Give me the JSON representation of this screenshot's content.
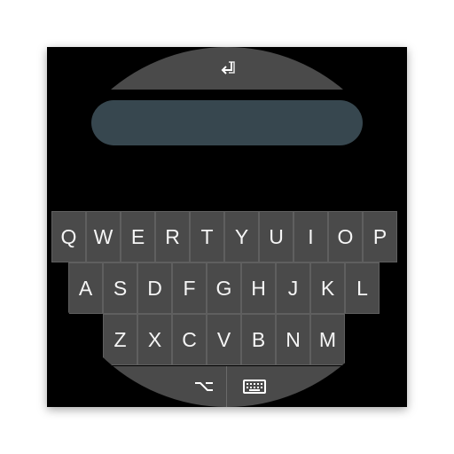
{
  "keyboard": {
    "row1": [
      "Q",
      "W",
      "E",
      "R",
      "T",
      "Y",
      "U",
      "I",
      "O",
      "P"
    ],
    "row2": [
      "A",
      "S",
      "D",
      "F",
      "G",
      "H",
      "J",
      "K",
      "L"
    ],
    "row3": [
      "Z",
      "X",
      "C",
      "V",
      "B",
      "N",
      "M"
    ]
  },
  "icons": {
    "enter": "enter-icon",
    "alt": "option-icon",
    "keyboard": "keyboard-icon"
  },
  "colors": {
    "key_background": "#4a4a4a",
    "text_field": "#37474f",
    "screen_background": "#000000",
    "key_text": "#f5f5f5"
  }
}
